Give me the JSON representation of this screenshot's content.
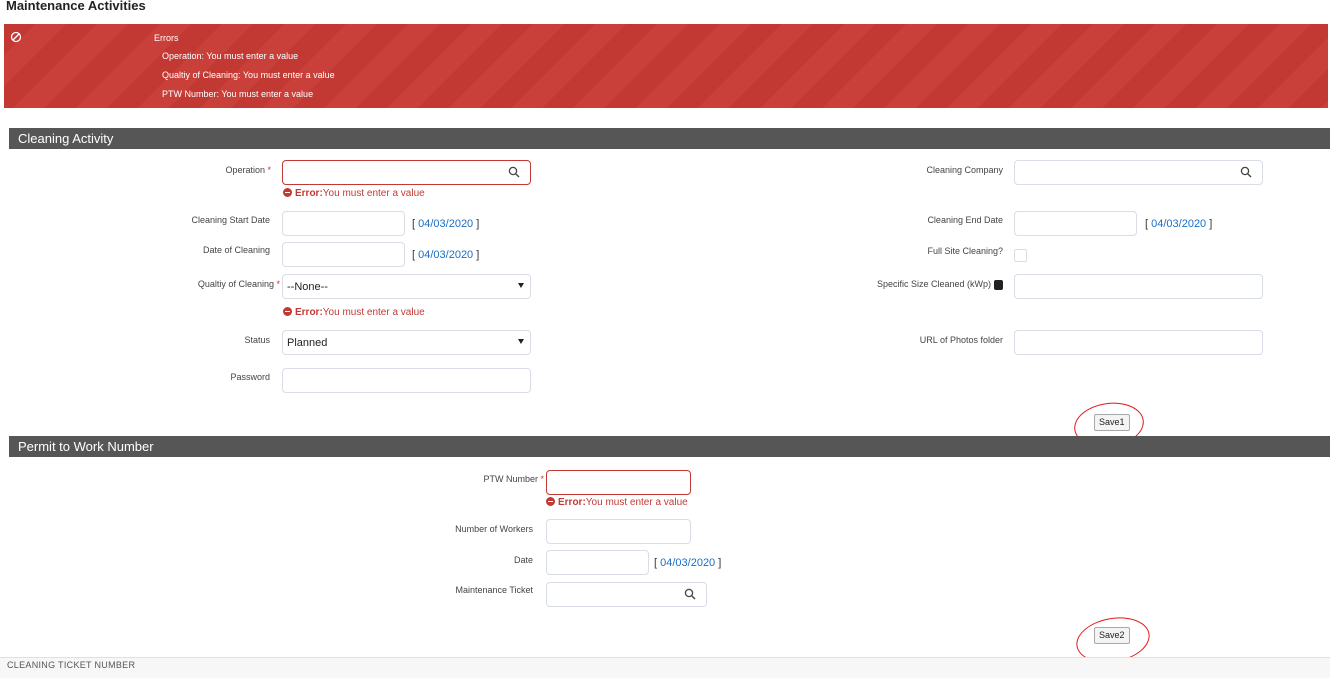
{
  "page": {
    "title": "Maintenance Activities"
  },
  "errors": {
    "title": "Errors",
    "items": [
      "Operation: You must enter a value",
      "Qualtiy of Cleaning: You must enter a value",
      "PTW Number: You must enter a value"
    ]
  },
  "cleaning": {
    "header": "Cleaning Activity",
    "operation": {
      "label": "Operation",
      "required": "*",
      "value": "",
      "error_prefix": "Error:",
      "error_text": "You must enter a value"
    },
    "cleaning_start_date": {
      "label": "Cleaning Start Date",
      "value": "",
      "today": "04/03/2020"
    },
    "date_of_cleaning": {
      "label": "Date of Cleaning",
      "value": "",
      "today": "04/03/2020"
    },
    "quality_of_cleaning": {
      "label": "Qualtiy of Cleaning",
      "required": "*",
      "selected": "--None--",
      "error_prefix": "Error:",
      "error_text": "You must enter a value"
    },
    "status": {
      "label": "Status",
      "selected": "Planned"
    },
    "password": {
      "label": "Password",
      "value": ""
    },
    "cleaning_company": {
      "label": "Cleaning Company",
      "value": ""
    },
    "cleaning_end_date": {
      "label": "Cleaning End Date",
      "value": "",
      "today": "04/03/2020"
    },
    "full_site_cleaning": {
      "label": "Full Site Cleaning?",
      "checked": false
    },
    "specific_size_cleaned": {
      "label": "Specific Size Cleaned (kWp)",
      "value": ""
    },
    "url_photos": {
      "label": "URL of Photos folder",
      "value": ""
    },
    "save_label": "Save1"
  },
  "permit": {
    "header": "Permit to Work Number",
    "ptw_number": {
      "label": "PTW Number",
      "required": "*",
      "value": "",
      "error_prefix": "Error:",
      "error_text": "You must enter a value"
    },
    "number_of_workers": {
      "label": "Number of Workers",
      "value": ""
    },
    "date": {
      "label": "Date",
      "value": "",
      "today": "04/03/2020"
    },
    "maintenance_ticket": {
      "label": "Maintenance Ticket",
      "value": ""
    },
    "save_label": "Save2"
  },
  "footer": {
    "text": "CLEANING TICKET NUMBER"
  },
  "colors": {
    "error_red": "#c23934",
    "header_gray": "#565656",
    "link_blue": "#1a6fc2",
    "annotation_red": "#e3191b"
  }
}
